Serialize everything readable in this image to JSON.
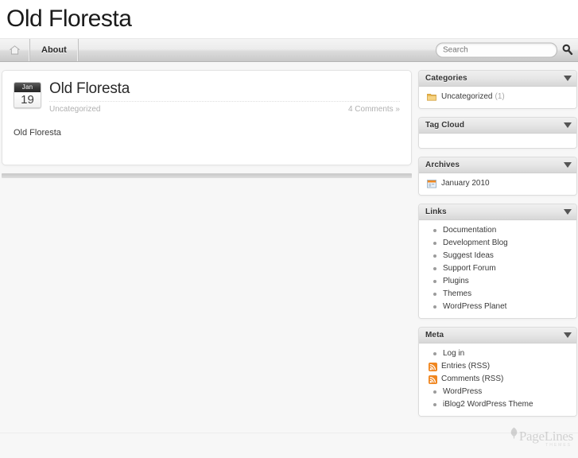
{
  "site": {
    "title": "Old Floresta"
  },
  "nav": {
    "home_icon": "home-icon",
    "items": [
      {
        "label": "About"
      }
    ]
  },
  "search": {
    "placeholder": "Search",
    "value": "",
    "icon": "search-icon"
  },
  "post": {
    "date": {
      "month": "Jan",
      "day": "19"
    },
    "title": "Old Floresta",
    "category": "Uncategorized",
    "comments": "4 Comments »",
    "body": "Old Floresta"
  },
  "sidebar": {
    "widgets": [
      {
        "title": "Categories",
        "toggle_icon": "chevron-down-icon",
        "items": [
          {
            "label": "Uncategorized",
            "count": "(1)",
            "icon": "folder-icon"
          }
        ]
      },
      {
        "title": "Tag Cloud",
        "toggle_icon": "chevron-down-icon",
        "items": []
      },
      {
        "title": "Archives",
        "toggle_icon": "chevron-down-icon",
        "items": [
          {
            "label": "January 2010",
            "count": "",
            "icon": "calendar-icon"
          }
        ]
      },
      {
        "title": "Links",
        "toggle_icon": "chevron-down-icon",
        "items": [
          {
            "label": "Documentation",
            "count": "",
            "icon": "bullet"
          },
          {
            "label": "Development Blog",
            "count": "",
            "icon": "bullet"
          },
          {
            "label": "Suggest Ideas",
            "count": "",
            "icon": "bullet"
          },
          {
            "label": "Support Forum",
            "count": "",
            "icon": "bullet"
          },
          {
            "label": "Plugins",
            "count": "",
            "icon": "bullet"
          },
          {
            "label": "Themes",
            "count": "",
            "icon": "bullet"
          },
          {
            "label": "WordPress Planet",
            "count": "",
            "icon": "bullet"
          }
        ]
      },
      {
        "title": "Meta",
        "toggle_icon": "chevron-down-icon",
        "items": [
          {
            "label": "Log in",
            "count": "",
            "icon": "bullet"
          },
          {
            "label": "Entries (RSS)",
            "count": "",
            "icon": "rss-icon"
          },
          {
            "label": "Comments (RSS)",
            "count": "",
            "icon": "rss-icon"
          },
          {
            "label": "WordPress",
            "count": "",
            "icon": "bullet"
          },
          {
            "label": "iBlog2 WordPress Theme",
            "count": "",
            "icon": "bullet"
          }
        ]
      }
    ]
  },
  "footer": {
    "logo_text": "PageLines",
    "logo_sub": "THEMES",
    "logo_icon": "leaf-icon"
  },
  "colors": {
    "page_background": "#f7f7f7",
    "panel_background": "#ffffff",
    "accent_orange": "#f08a24",
    "folder_yellow": "#f0c04a",
    "text_primary": "#2a2a2a",
    "text_muted": "#b0b0b0"
  }
}
